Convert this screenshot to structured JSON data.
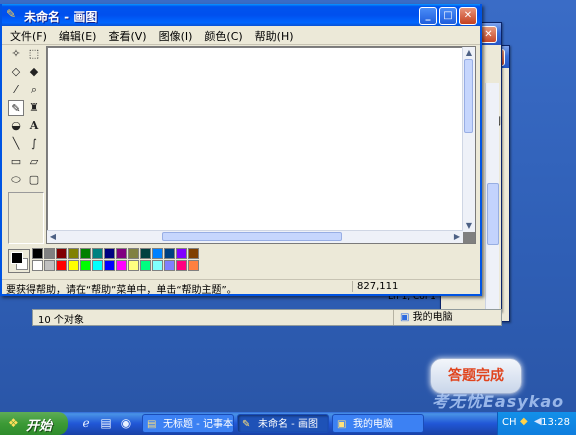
{
  "paint": {
    "title": "未命名 - 画图",
    "menu": [
      "文件(F)",
      "编辑(E)",
      "查看(V)",
      "图像(I)",
      "颜色(C)",
      "帮助(H)"
    ],
    "status_message": "要获得帮助，请在“帮助”菜单中，单击“帮助主题”。",
    "coordinates": "827,111",
    "palette": [
      "#000000",
      "#808080",
      "#800000",
      "#808000",
      "#008000",
      "#008080",
      "#000080",
      "#800080",
      "#808040",
      "#004040",
      "#0080ff",
      "#004080",
      "#8000ff",
      "#804000",
      "#ffffff",
      "#c0c0c0",
      "#ff0000",
      "#ffff00",
      "#00ff00",
      "#00ffff",
      "#0000ff",
      "#ff00ff",
      "#ffff80",
      "#00ff80",
      "#80ffff",
      "#8080ff",
      "#ff0080",
      "#ff8040"
    ]
  },
  "background_window": {
    "status_text": "Ln 1, Col 1",
    "label_fragment": "到"
  },
  "explorer": {
    "object_count": "10 个对象",
    "location": "我的电脑"
  },
  "finish_button": "答题完成",
  "watermark": "考无忧Easykao",
  "taskbar": {
    "start_label": "开始",
    "items": [
      {
        "label": "无标题 - 记事本",
        "icon": "notepad-icon"
      },
      {
        "label": "未命名 - 画图",
        "icon": "paint-icon"
      },
      {
        "label": "我的电脑",
        "icon": "computer-icon"
      }
    ],
    "active_index": 1,
    "ime": "CH",
    "clock": "13:28"
  }
}
